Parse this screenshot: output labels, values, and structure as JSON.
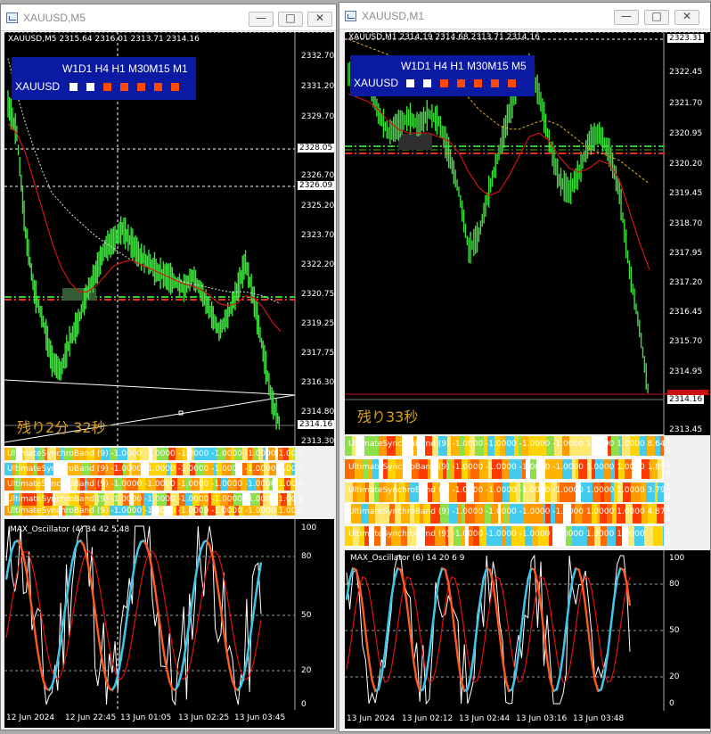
{
  "windows": [
    {
      "title": "XAUUSD,M5",
      "price_info": "XAUUSD,M5  2315.64 2316.01 2313.71 2314.16",
      "mtf": {
        "tfs": "W1D1 H4 H1 M30M15 M1",
        "symbol": "XAUUSD",
        "squares": [
          "#ffffff",
          "#ffffff",
          "#ff4a00",
          "#ff4a00",
          "#ff4a00",
          "#ff4a00",
          "#ff4a00"
        ]
      },
      "countdown": "残り2分 32秒",
      "price_axis": [
        "2332.70",
        "2331.20",
        "2329.70",
        "2326.70",
        "2325.20",
        "2323.70",
        "2322.20",
        "2320.75",
        "2319.25",
        "2317.75",
        "2316.30",
        "2314.80",
        "2313.30"
      ],
      "price_tags": {
        "top": "2328.05",
        "mid": "2326.09",
        "current": "2314.16"
      },
      "bands": [
        "UltimateSynchroBand (9) -1.0000 -1.0000 -1.0000 -1.0000 -1.0000 1.0000 37",
        "UltimateSynchroBand (9) -1.0000 -1.0000 -1.0000 -1.0000 -1.0000 1.0000 8.6",
        "UltimateSynchroBand (9) -1.0000 -1.0000 -1.0000 -1.0000 -1.0000 1.0000 1.8",
        "UltimateSynchroBand (9) -1.0000 -1.0000 -1.0000 -1.0000 -1.0000 1.0000 3.7",
        "UltimateSynchroBand (9) -1.0000 -1.0000 -1.0000 -1.0000 -1.0000 1.0000"
      ],
      "band_scale": [
        "0",
        "0",
        "0",
        "0",
        "0"
      ],
      "osc_label": "MAX_Oscillator (4) 34 42 5 48",
      "osc_levels": [
        "100",
        "80",
        "50",
        "20",
        "0"
      ],
      "time_labels": [
        "12 Jun 2024",
        "12 Jun 22:45",
        "13 Jun 01:05",
        "13 Jun 02:25",
        "13 Jun 03:45"
      ]
    },
    {
      "title": "XAUUSD,M1",
      "price_info": "XAUUSD,M1  2314.19 2314.68 2313.71 2314.16",
      "mtf": {
        "tfs": "W1D1 H4 H1 M30M15 M5",
        "symbol": "XAUUSD",
        "squares": [
          "#ffffff",
          "#ffffff",
          "#ff4a00",
          "#ff4a00",
          "#ff4a00",
          "#ff4a00",
          "#ff4a00"
        ]
      },
      "countdown": "残り33秒",
      "price_axis": [
        "2322.45",
        "2321.70",
        "2320.95",
        "2320.20",
        "2319.45",
        "2318.70",
        "2317.95",
        "2317.20",
        "2316.45",
        "2315.70",
        "2314.95",
        "2313.45"
      ],
      "price_tags": {
        "top": "2323.31",
        "current": "2314.16"
      },
      "bands": [
        "UltimateSynchroBand (9) -1.0000 -1.0000 -1.0000 -1.0000 1.0000 1.0000 8.6494 25",
        "UltimateSynchroBand (9) -1.0000 -1.0000 -1.0000 -1.0000 1.0000 1.0000 1.8564 33",
        "UltimateSynchroBand (9) -1.0000 -1.0000 -1.0000 -1.0000 1.0000 1.0000 3.7943 23",
        "UltimateSynchroBand (9) -1.0000 -1.0000 -1.0000 -1.0000 1.0000 1.0000 4.8701 11",
        "UltimateSynchroBand (9) -1.0000 -1.0000 -1.0000 -1.0000 1.0000 1.0000"
      ],
      "band_scale": [
        "1 0",
        "1 0",
        "1 0",
        "1 0",
        "1 0"
      ],
      "osc_label": "MAX_Oscillator (6) 14 20 6 9",
      "osc_levels": [
        "100",
        "80",
        "50",
        "20",
        "0"
      ],
      "time_labels": [
        "13 Jun 2024",
        "13 Jun 02:12",
        "13 Jun 02:44",
        "13 Jun 03:16",
        "13 Jun 03:48"
      ]
    }
  ],
  "chart_data": [
    {
      "type": "line",
      "title": "XAUUSD,M5",
      "ylim": [
        2313.3,
        2333.5
      ],
      "series": [
        {
          "values": [
            2330.5,
            2329.0,
            2324.0,
            2321.0,
            2319.5,
            2317.5,
            2317.0,
            2318.5,
            2319.5,
            2321.0,
            2322.0,
            2323.2,
            2323.6,
            2324.2,
            2323.5,
            2322.8,
            2322.5,
            2322.0,
            2321.8,
            2321.5,
            2321.2,
            2321.8,
            2321.0,
            2320.0,
            2319.0,
            2319.8,
            2321.0,
            2322.5,
            2320.5,
            2318.0,
            2315.5,
            2314.16
          ]
        },
        {
          "values": [
            2329.5,
            2329.0,
            2328.0,
            2326.5,
            2325.0,
            2323.5,
            2322.3,
            2321.5,
            2321.0,
            2321.0,
            2321.3,
            2321.8,
            2322.3,
            2322.5,
            2322.6,
            2322.4,
            2322.2,
            2322.0,
            2321.8,
            2321.6,
            2321.4,
            2321.3,
            2321.1,
            2320.8,
            2320.4,
            2320.3,
            2320.4,
            2320.8,
            2320.7,
            2320.2,
            2319.5,
            2319.0
          ]
        },
        {
          "values": [
            2332.8,
            2331.0,
            2329.5,
            2328.2,
            2327.0,
            2326.0,
            2325.5,
            2325.0,
            2324.6,
            2324.2,
            2323.8,
            2323.5,
            2323.2,
            2322.9,
            2322.6,
            2322.4,
            2322.2,
            2322.0,
            2321.8,
            2321.6,
            2321.5,
            2321.4,
            2321.3,
            2321.2,
            2321.1,
            2321.0,
            2321.0,
            2321.0,
            2320.9,
            2320.8,
            2320.6,
            2320.4
          ]
        }
      ]
    },
    {
      "type": "line",
      "title": "XAUUSD,M1",
      "ylim": [
        2313.45,
        2323.4
      ],
      "series": [
        {
          "values": [
            2322.5,
            2322.6,
            2322.4,
            2321.5,
            2321.0,
            2321.2,
            2321.4,
            2321.2,
            2321.5,
            2321.3,
            2320.5,
            2319.5,
            2318.0,
            2318.4,
            2319.5,
            2320.5,
            2321.5,
            2322.3,
            2322.7,
            2322.0,
            2320.8,
            2319.8,
            2319.5,
            2320.0,
            2320.8,
            2321.0,
            2320.5,
            2319.5,
            2317.5,
            2316.0,
            2314.16
          ]
        },
        {
          "values": [
            2322.0,
            2321.9,
            2321.8,
            2321.6,
            2321.3,
            2321.1,
            2321.0,
            2321.0,
            2321.0,
            2320.9,
            2320.8,
            2320.5,
            2320.0,
            2319.6,
            2319.4,
            2319.5,
            2319.9,
            2320.4,
            2320.9,
            2321.0,
            2320.8,
            2320.4,
            2320.1,
            2320.0,
            2320.1,
            2320.3,
            2320.2,
            2319.8,
            2319.0,
            2318.2,
            2317.5
          ]
        },
        {
          "values": [
            2323.4,
            2323.3,
            2323.2,
            2323.1,
            2323.0,
            2322.9,
            2322.8,
            2322.7,
            2322.6,
            2322.5,
            2322.3,
            2322.1,
            2321.9,
            2321.6,
            2321.4,
            2321.2,
            2321.1,
            2321.1,
            2321.2,
            2321.3,
            2321.3,
            2321.2,
            2321.0,
            2320.8,
            2320.6,
            2320.5,
            2320.4,
            2320.3,
            2320.1,
            2319.9,
            2319.7
          ]
        }
      ]
    }
  ]
}
